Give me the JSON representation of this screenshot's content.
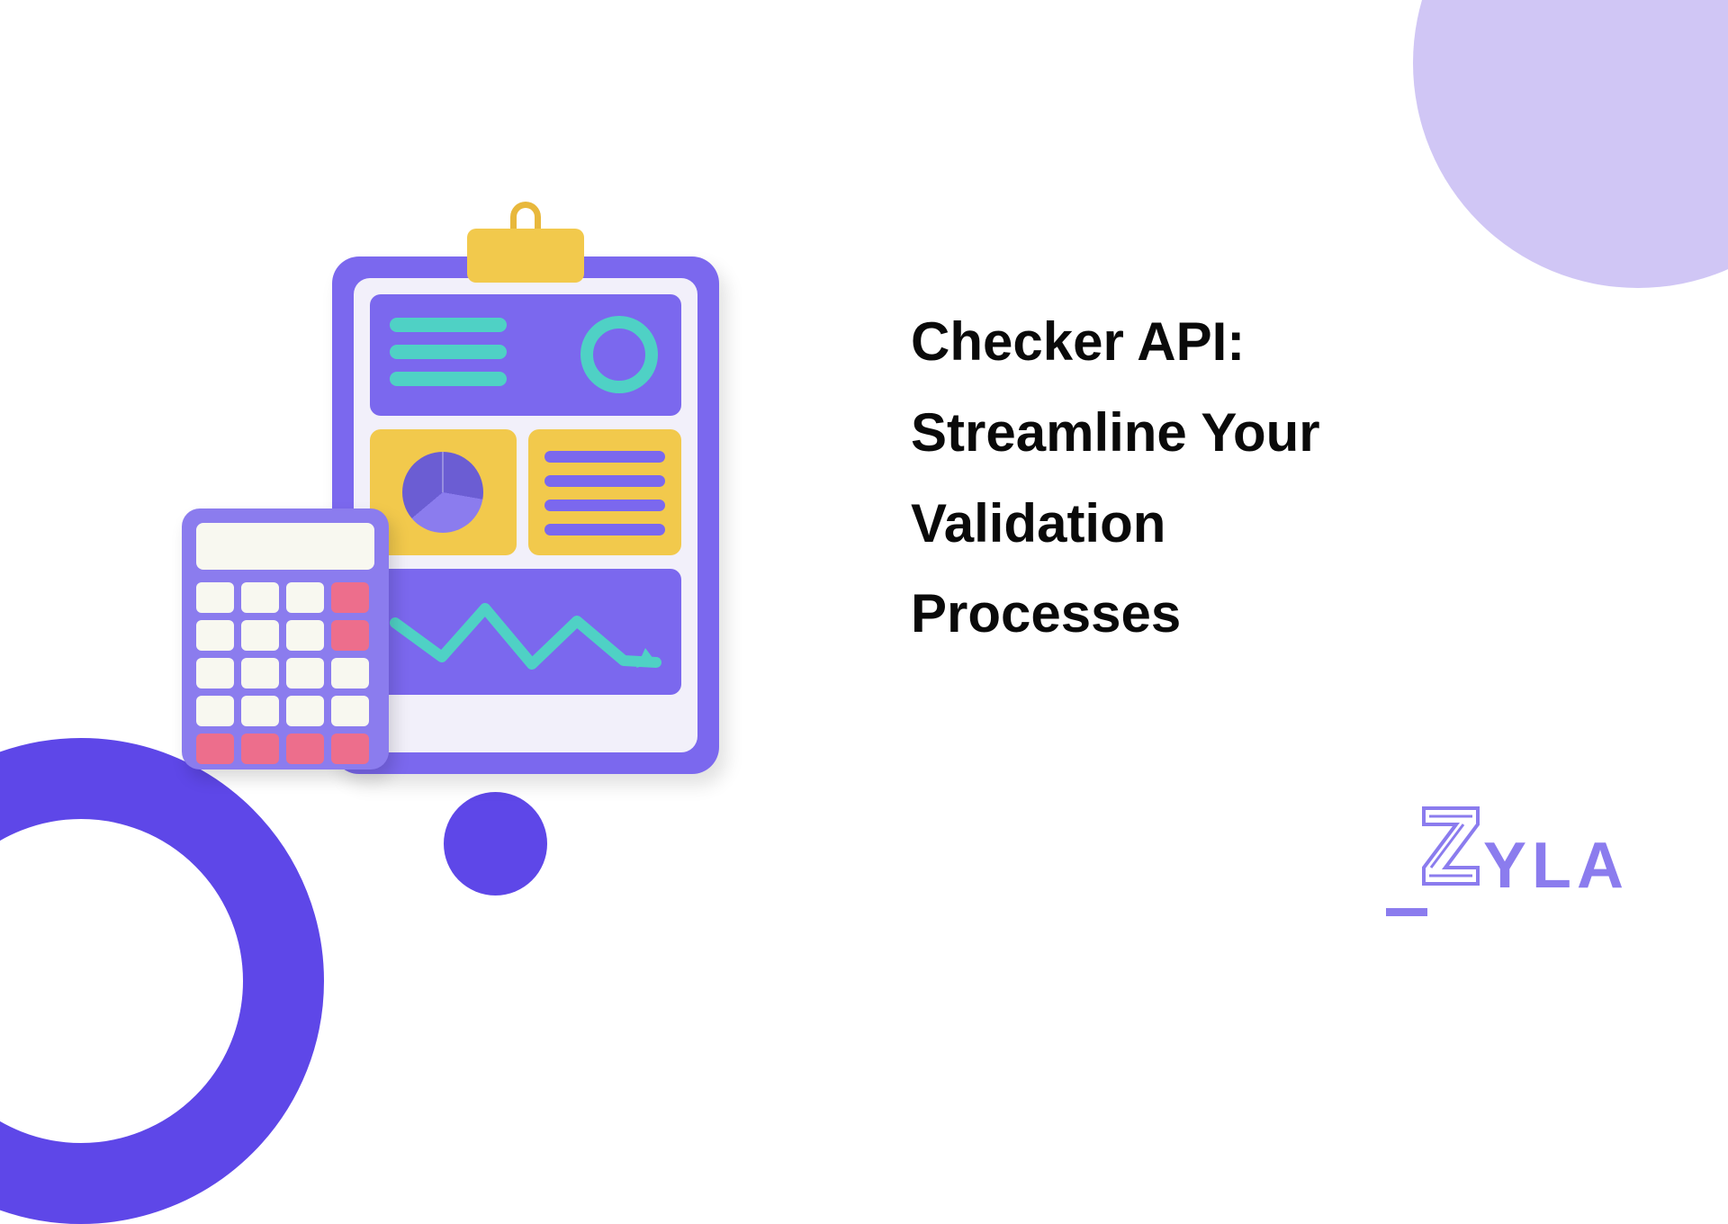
{
  "title": "Checker API: Streamline Your Validation Processes",
  "logo_text": "YLA",
  "colors": {
    "primary": "#5E47E8",
    "secondary": "#8B7CEE",
    "accent_yellow": "#F2C94C",
    "accent_teal": "#4FD1C5",
    "accent_pink": "#ED6E8C",
    "light_purple": "#d0c6f5"
  }
}
